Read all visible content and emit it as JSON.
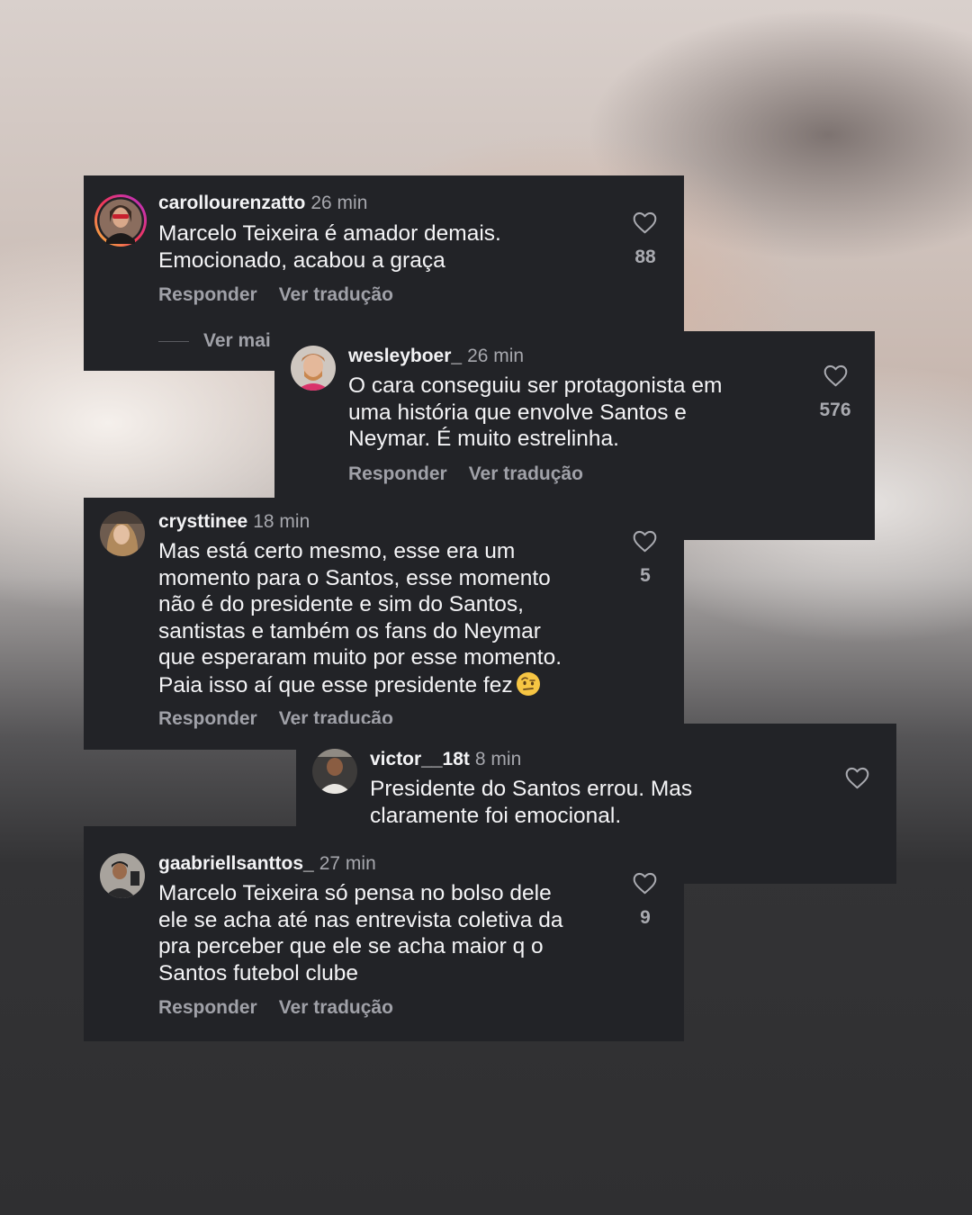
{
  "comments": [
    {
      "username": "carollourenzatto",
      "time": "26 min",
      "text": "Marcelo Teixeira é amador demais.\nEmocionado, acabou a graça",
      "likes": "88",
      "reply_label": "Responder",
      "translate_label": "Ver tradução",
      "more_replies_label": "Ver mai"
    },
    {
      "username": "wesleyboer_",
      "time": "26 min",
      "text": "O cara conseguiu ser protagonista em\numa história que envolve Santos e\nNeymar. É muito estrelinha.",
      "likes": "576",
      "reply_label": "Responder",
      "translate_label": "Ver tradução"
    },
    {
      "username": "crysttinee",
      "time": "18 min",
      "text": "Mas está certo mesmo, esse era um\nmomento para o Santos, esse momento\nnão é do presidente e sim do Santos,\nsantistas e também os fans do Neymar\nque esperaram muito por esse momento.\nPaia isso aí que esse presidente fez",
      "emoji": "raised-eyebrow-emoji",
      "likes": "5",
      "reply_label": "Responder",
      "translate_label": "Ver tradução"
    },
    {
      "username": "victor__18t",
      "time": "8 min",
      "text": "Presidente do Santos errou. Mas\nclaramente foi emocional."
    },
    {
      "username": "gaabriellsanttos_",
      "time": "27 min",
      "text": "Marcelo Teixeira só pensa no bolso dele\nele se acha até nas entrevista coletiva da\npra perceber que ele se acha maior q o\nSantos futebol clube",
      "likes": "9",
      "reply_label": "Responder",
      "translate_label": "Ver tradução"
    }
  ],
  "icons": {
    "like": "heart-outline-icon",
    "story_ring": "instagram-story-ring"
  },
  "colors": {
    "card_bg": "#222327",
    "text_primary": "#f4f4f6",
    "text_secondary": "#a0a1a8"
  }
}
